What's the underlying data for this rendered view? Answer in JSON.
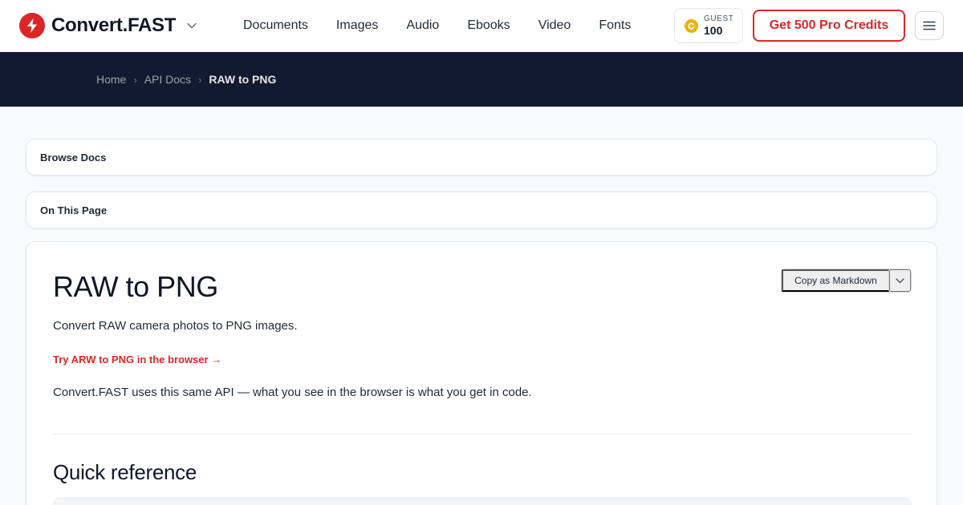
{
  "brand": {
    "name": "Convert.FAST",
    "accent": "#dc2626"
  },
  "nav": [
    "Documents",
    "Images",
    "Audio",
    "Ebooks",
    "Video",
    "Fonts"
  ],
  "credits": {
    "label": "GUEST",
    "value": "100"
  },
  "header": {
    "pro_button": "Get 500 Pro Credits"
  },
  "breadcrumb": {
    "home": "Home",
    "section": "API Docs",
    "current": "RAW to PNG"
  },
  "panels": {
    "browse": "Browse Docs",
    "on_this_page": "On This Page"
  },
  "content": {
    "title": "RAW to PNG",
    "copy_button": "Copy as Markdown",
    "description": "Convert RAW camera photos to PNG images.",
    "try_link": "Try ARW to PNG in the browser →",
    "api_note": "Convert.FAST uses this same API — what you see in the browser is what you get in code.",
    "section_heading": "Quick reference"
  },
  "icons": {
    "logo": "bolt-logo-icon",
    "credits": "coin-icon",
    "menu": "hamburger-menu-icon",
    "chevron": "chevron-down-icon"
  }
}
